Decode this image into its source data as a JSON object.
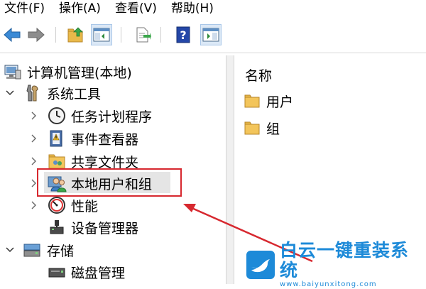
{
  "menu": {
    "file": "文件(F)",
    "action": "操作(A)",
    "view": "查看(V)",
    "help": "帮助(H)"
  },
  "toolbar": {
    "icons": [
      "back-arrow-icon",
      "forward-arrow-icon",
      "up-folder-icon",
      "show-hide-tree-icon",
      "export-list-icon",
      "help-icon",
      "action-pane-icon"
    ]
  },
  "tree": {
    "root": "计算机管理(本地)",
    "system_tools": "系统工具",
    "task_scheduler": "任务计划程序",
    "event_viewer": "事件查看器",
    "shared_folders": "共享文件夹",
    "local_users_groups": "本地用户和组",
    "performance": "性能",
    "device_manager": "设备管理器",
    "storage": "存储",
    "disk_management": "磁盘管理"
  },
  "list": {
    "column_name": "名称",
    "items": [
      "用户",
      "组"
    ]
  },
  "watermark": {
    "brand": "白云一键重装系统",
    "url": "www.baiyunxitong.com"
  },
  "colors": {
    "highlight_red": "#d7282f",
    "brand_blue": "#1d8ad8",
    "folder_yellow": "#f3c55b"
  }
}
